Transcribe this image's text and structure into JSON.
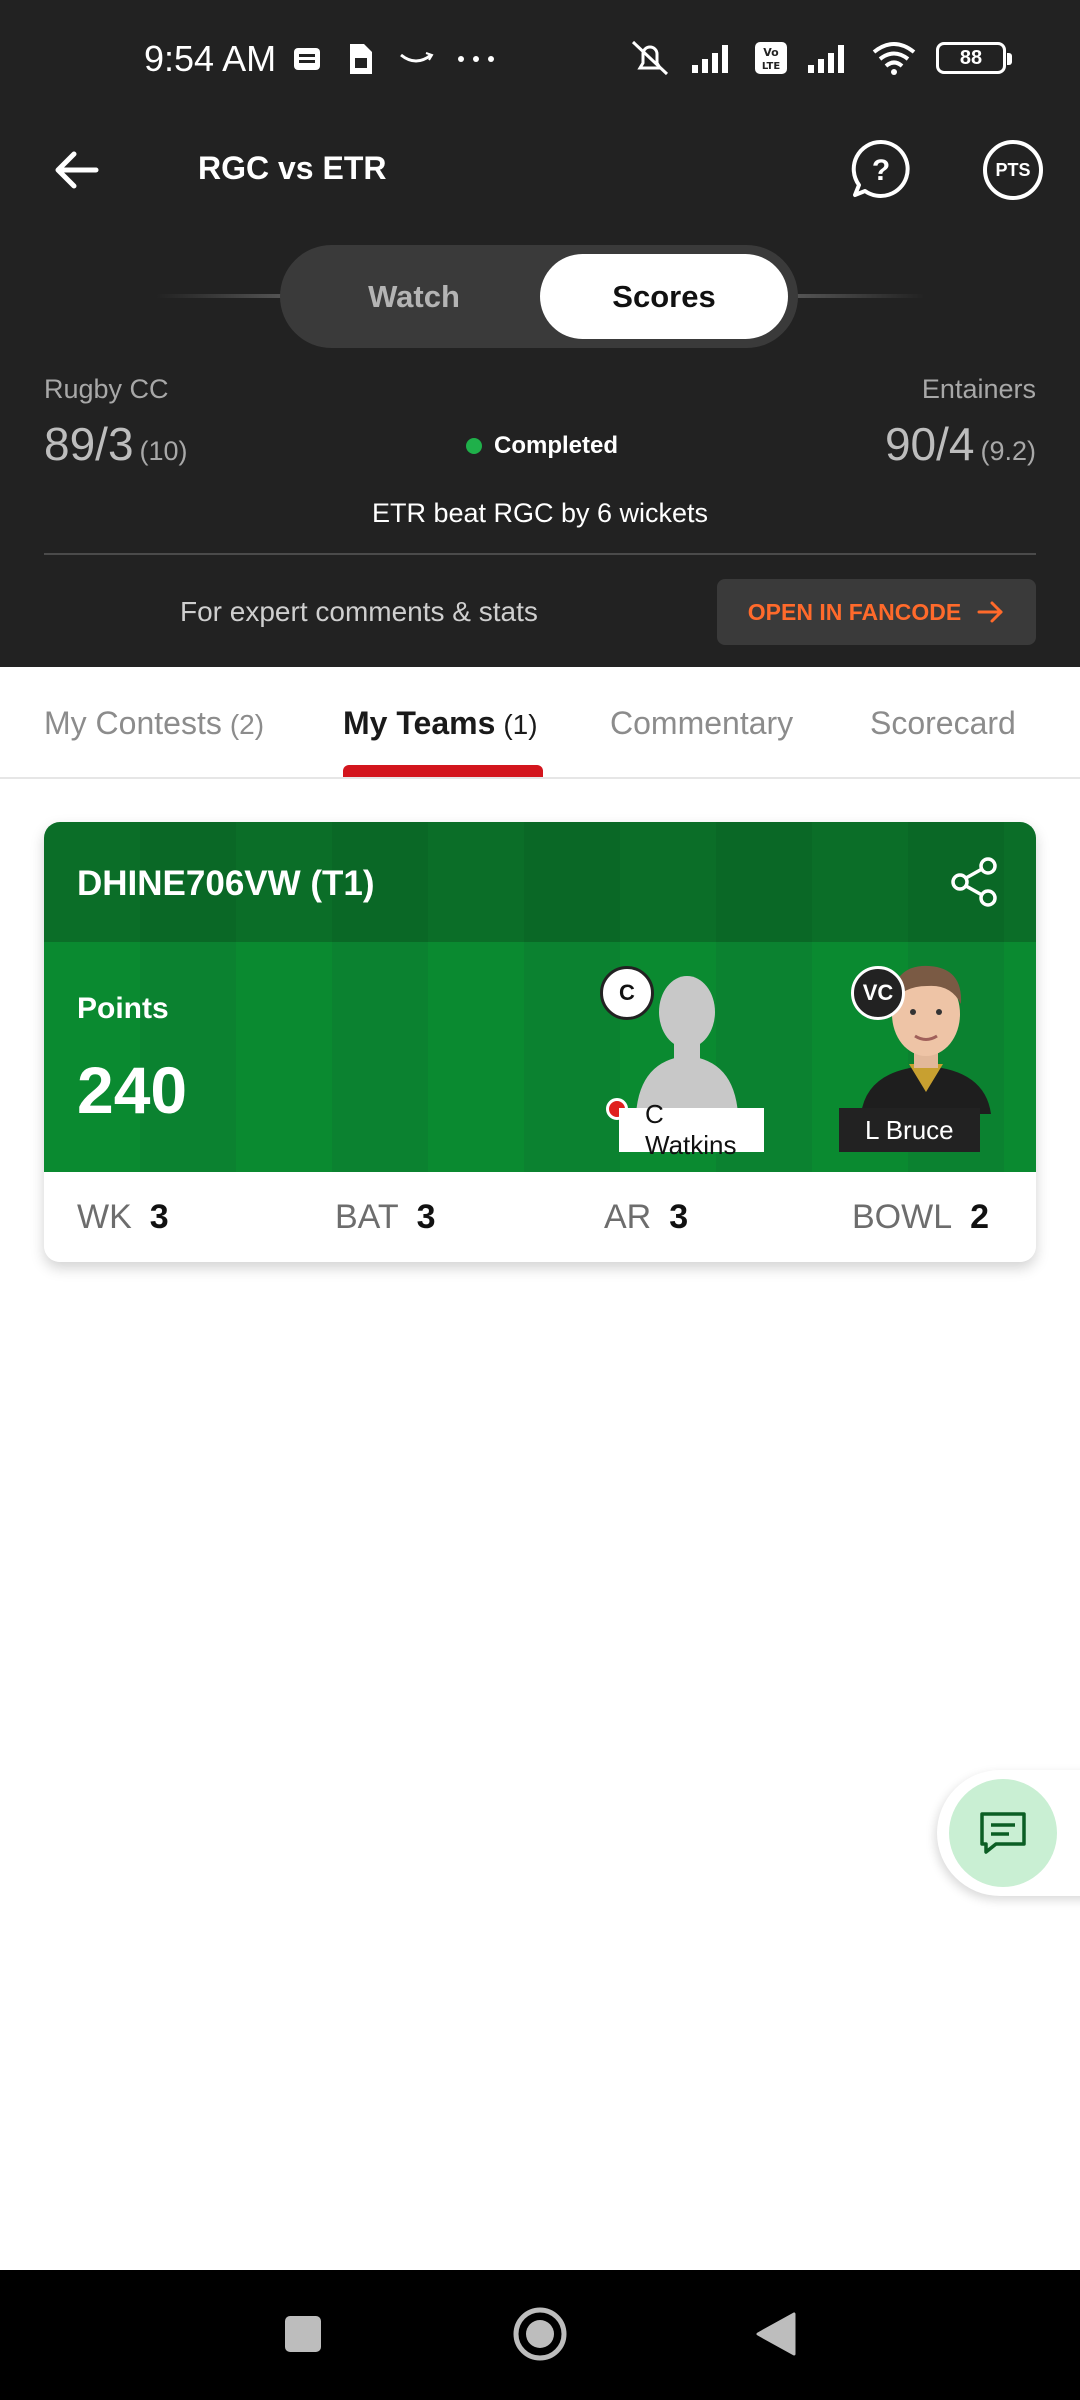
{
  "status_bar": {
    "time": "9:54 AM",
    "battery": "88",
    "icons_left": [
      "message-icon",
      "sim-icon",
      "amazon-icon",
      "more-icon"
    ],
    "icons_right": [
      "mute-icon",
      "signal-icon",
      "volte-icon",
      "signal-icon",
      "wifi-icon"
    ]
  },
  "header": {
    "title": "RGC vs ETR",
    "pts_label": "PTS"
  },
  "view_toggle": {
    "watch": "Watch",
    "scores": "Scores",
    "selected": "Scores"
  },
  "match": {
    "team1": {
      "name": "Rugby CC",
      "score": "89/3",
      "overs": "(10)"
    },
    "team2": {
      "name": "Entainers",
      "score": "90/4",
      "overs": "(9.2)"
    },
    "status": "Completed",
    "result": "ETR beat RGC by 6 wickets",
    "expert_text": "For expert comments & stats",
    "fancode_button": "OPEN IN FANCODE"
  },
  "tabs": [
    {
      "label": "My Contests",
      "count": "(2)"
    },
    {
      "label": "My Teams",
      "count": "(1)"
    },
    {
      "label": "Commentary",
      "count": ""
    },
    {
      "label": "Scorecard",
      "count": ""
    }
  ],
  "active_tab": "My Teams",
  "team_card": {
    "name": "DHINE706VW (T1)",
    "points_label": "Points",
    "points": "240",
    "captain": {
      "badge": "C",
      "name": "C Watkins"
    },
    "vice_captain": {
      "badge": "VC",
      "name": "L Bruce"
    },
    "stats": [
      {
        "label": "WK",
        "value": "3"
      },
      {
        "label": "BAT",
        "value": "3"
      },
      {
        "label": "AR",
        "value": "3"
      },
      {
        "label": "BOWL",
        "value": "2"
      }
    ]
  },
  "colors": {
    "header_bg": "#222222",
    "accent_red": "#d3151d",
    "fancode_orange": "#ff6a2b",
    "pitch_green": "#0a8a30",
    "completed_green": "#1fb04a"
  }
}
